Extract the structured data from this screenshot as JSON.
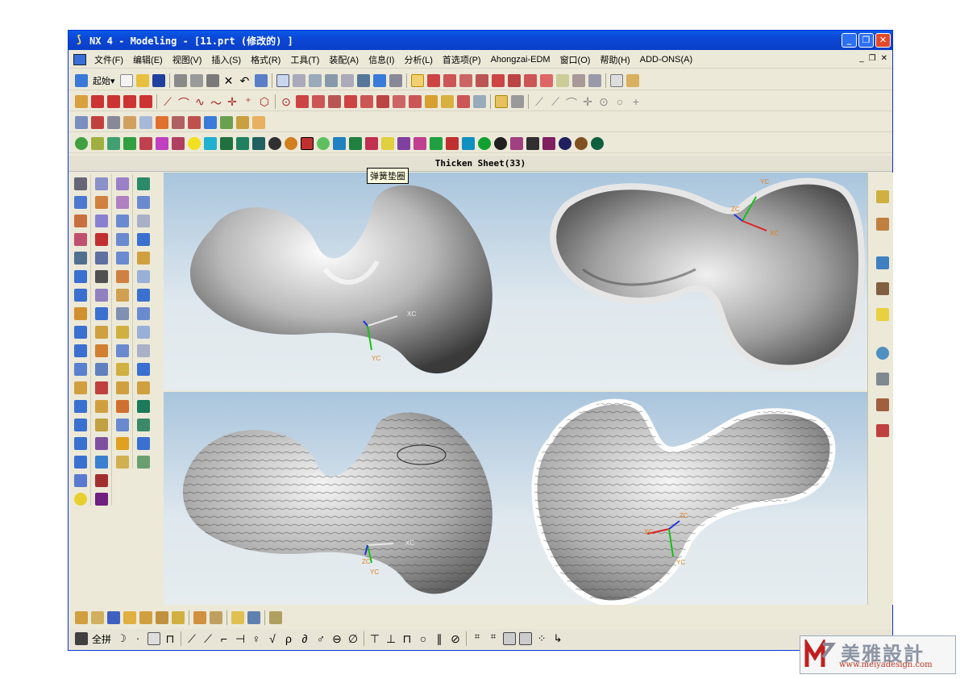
{
  "window": {
    "title": "NX 4 - Modeling - [11.prt (修改的) ]"
  },
  "menu": {
    "items": [
      "文件(F)",
      "编辑(E)",
      "视图(V)",
      "插入(S)",
      "格式(R)",
      "工具(T)",
      "装配(A)",
      "信息(I)",
      "分析(L)",
      "首选项(P)",
      "Ahongzai-EDM",
      "窗口(O)",
      "帮助(H)",
      "ADD-ONS(A)"
    ]
  },
  "toolbar": {
    "start_label": "起始▾"
  },
  "status": {
    "command": "Thicken Sheet(33)"
  },
  "tooltip": {
    "text": "弹簧垫圈"
  },
  "axes": {
    "xc": "XC",
    "yc": "YC",
    "zc": "ZC"
  },
  "bottom": {
    "fullspell": "全拼"
  },
  "watermark": {
    "name": "美雅設計",
    "url": "www.meiyadesign.com"
  },
  "colors": {
    "title_bar": "#0a46d4",
    "viewport_top": "#a9c5dd",
    "viewport_bottom": "#e6ecef",
    "axis_x": "#e02020",
    "axis_y": "#18c018",
    "axis_z": "#2030d8"
  }
}
